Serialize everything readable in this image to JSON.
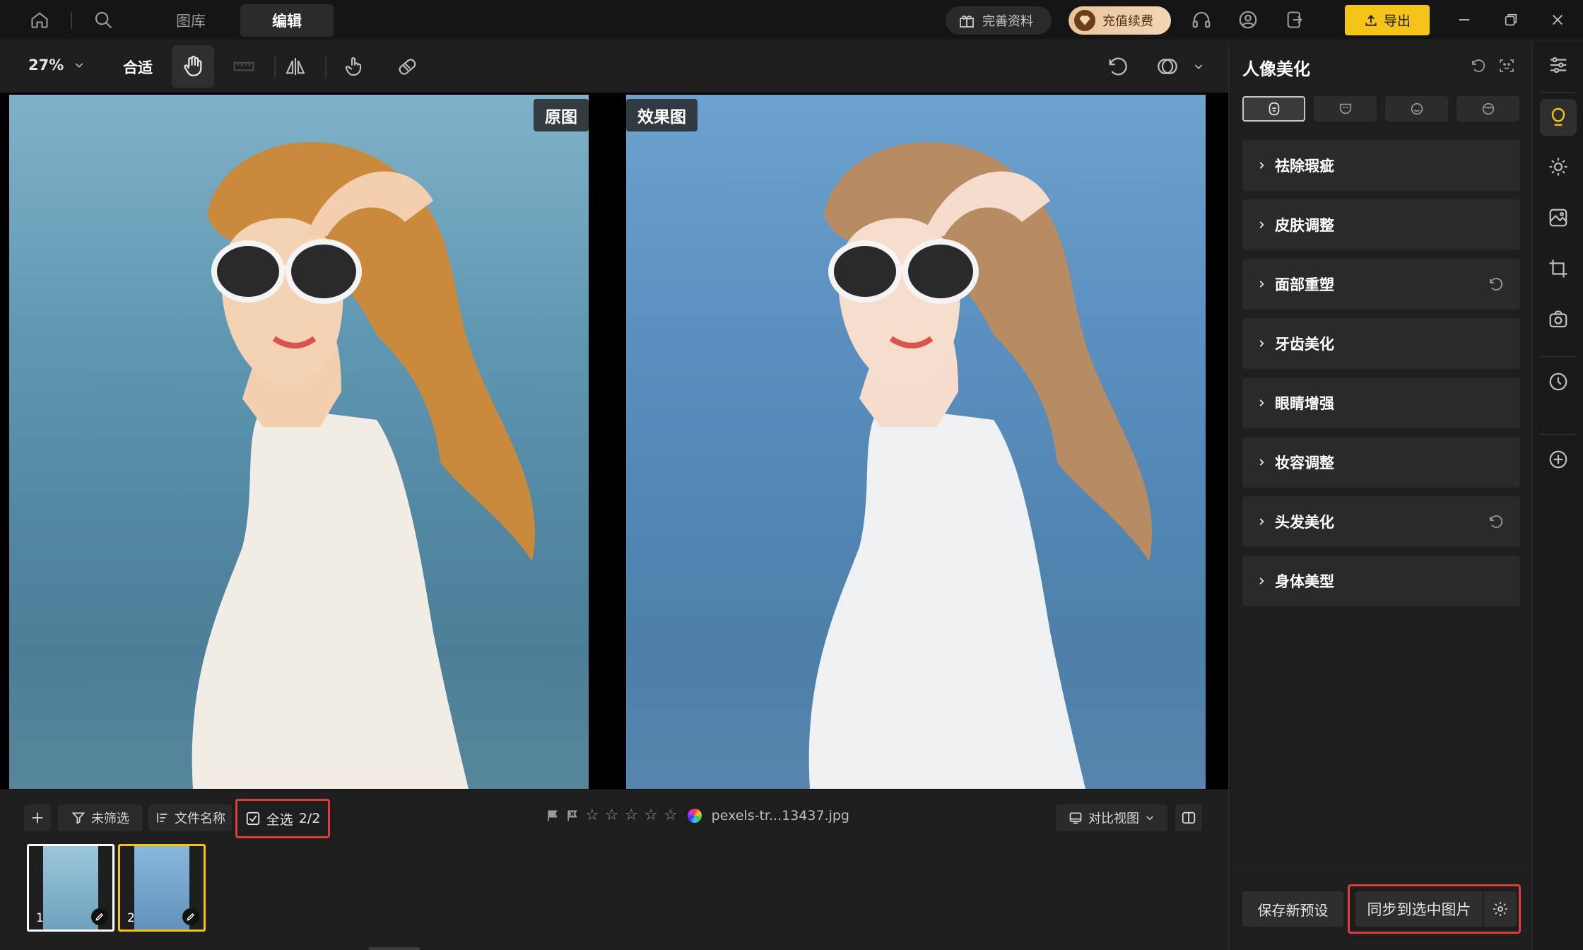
{
  "topbar": {
    "tabs": [
      {
        "label": "图库",
        "active": false
      },
      {
        "label": "编辑",
        "active": true
      }
    ],
    "profile_label": "完善资料",
    "vip_label": "充值续费",
    "export_label": "导出"
  },
  "toolbar": {
    "zoom": "27%",
    "fit_label": "合适"
  },
  "canvas": {
    "original_label": "原图",
    "effect_label": "效果图"
  },
  "bottom": {
    "filter_label": "未筛选",
    "sort_label": "文件名称",
    "select_all_label": "全选",
    "select_count": "2/2",
    "filename": "pexels-tr...13437.jpg",
    "rating": 0,
    "compare_view_label": "对比视图",
    "thumbnails": [
      {
        "number": "1",
        "selected": true
      },
      {
        "number": "2",
        "selected": false
      }
    ]
  },
  "panel": {
    "title": "人像美化",
    "sections": [
      {
        "label": "祛除瑕疵",
        "has_reset": false
      },
      {
        "label": "皮肤调整",
        "has_reset": false
      },
      {
        "label": "面部重塑",
        "has_reset": true
      },
      {
        "label": "牙齿美化",
        "has_reset": false
      },
      {
        "label": "眼睛增强",
        "has_reset": false
      },
      {
        "label": "妆容调整",
        "has_reset": false
      },
      {
        "label": "头发美化",
        "has_reset": true
      },
      {
        "label": "身体美型",
        "has_reset": false
      }
    ],
    "save_preset_label": "保存新预设",
    "sync_label": "同步到选中图片"
  },
  "colors": {
    "accent": "#f5c419",
    "highlight_border": "#e13b3b",
    "background": "#1e1e1e"
  }
}
